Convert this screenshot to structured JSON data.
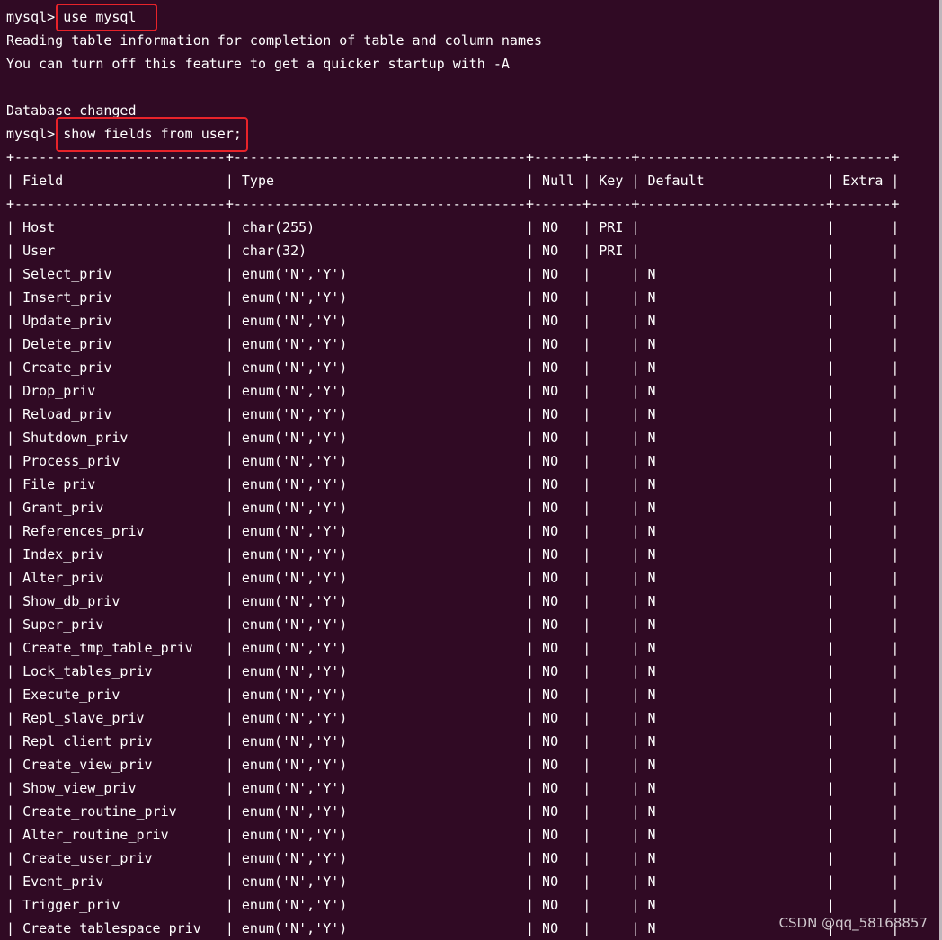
{
  "terminal": {
    "prompt": "mysql> ",
    "colors": {
      "background": "#300a24",
      "text": "#ffffff",
      "highlight_border": "#e8232a"
    },
    "lines": [
      {
        "prefix": "mysql> ",
        "text": "use mysql"
      },
      {
        "prefix": "",
        "text": "Reading table information for completion of table and column names"
      },
      {
        "prefix": "",
        "text": "You can turn off this feature to get a quicker startup with -A"
      },
      {
        "prefix": "",
        "text": ""
      },
      {
        "prefix": "",
        "text": "Database changed"
      },
      {
        "prefix": "mysql> ",
        "text": "show fields from user;"
      }
    ]
  },
  "table": {
    "border_line": "+--------------------------+------------------------------------+------+-----+-----------------------+-------+",
    "headers": [
      "Field",
      "Type",
      "Null",
      "Key",
      "Default",
      "Extra"
    ],
    "rows": [
      [
        "Host",
        "char(255)",
        "NO",
        "PRI",
        "",
        ""
      ],
      [
        "User",
        "char(32)",
        "NO",
        "PRI",
        "",
        ""
      ],
      [
        "Select_priv",
        "enum('N','Y')",
        "NO",
        "",
        "N",
        ""
      ],
      [
        "Insert_priv",
        "enum('N','Y')",
        "NO",
        "",
        "N",
        ""
      ],
      [
        "Update_priv",
        "enum('N','Y')",
        "NO",
        "",
        "N",
        ""
      ],
      [
        "Delete_priv",
        "enum('N','Y')",
        "NO",
        "",
        "N",
        ""
      ],
      [
        "Create_priv",
        "enum('N','Y')",
        "NO",
        "",
        "N",
        ""
      ],
      [
        "Drop_priv",
        "enum('N','Y')",
        "NO",
        "",
        "N",
        ""
      ],
      [
        "Reload_priv",
        "enum('N','Y')",
        "NO",
        "",
        "N",
        ""
      ],
      [
        "Shutdown_priv",
        "enum('N','Y')",
        "NO",
        "",
        "N",
        ""
      ],
      [
        "Process_priv",
        "enum('N','Y')",
        "NO",
        "",
        "N",
        ""
      ],
      [
        "File_priv",
        "enum('N','Y')",
        "NO",
        "",
        "N",
        ""
      ],
      [
        "Grant_priv",
        "enum('N','Y')",
        "NO",
        "",
        "N",
        ""
      ],
      [
        "References_priv",
        "enum('N','Y')",
        "NO",
        "",
        "N",
        ""
      ],
      [
        "Index_priv",
        "enum('N','Y')",
        "NO",
        "",
        "N",
        ""
      ],
      [
        "Alter_priv",
        "enum('N','Y')",
        "NO",
        "",
        "N",
        ""
      ],
      [
        "Show_db_priv",
        "enum('N','Y')",
        "NO",
        "",
        "N",
        ""
      ],
      [
        "Super_priv",
        "enum('N','Y')",
        "NO",
        "",
        "N",
        ""
      ],
      [
        "Create_tmp_table_priv",
        "enum('N','Y')",
        "NO",
        "",
        "N",
        ""
      ],
      [
        "Lock_tables_priv",
        "enum('N','Y')",
        "NO",
        "",
        "N",
        ""
      ],
      [
        "Execute_priv",
        "enum('N','Y')",
        "NO",
        "",
        "N",
        ""
      ],
      [
        "Repl_slave_priv",
        "enum('N','Y')",
        "NO",
        "",
        "N",
        ""
      ],
      [
        "Repl_client_priv",
        "enum('N','Y')",
        "NO",
        "",
        "N",
        ""
      ],
      [
        "Create_view_priv",
        "enum('N','Y')",
        "NO",
        "",
        "N",
        ""
      ],
      [
        "Show_view_priv",
        "enum('N','Y')",
        "NO",
        "",
        "N",
        ""
      ],
      [
        "Create_routine_priv",
        "enum('N','Y')",
        "NO",
        "",
        "N",
        ""
      ],
      [
        "Alter_routine_priv",
        "enum('N','Y')",
        "NO",
        "",
        "N",
        ""
      ],
      [
        "Create_user_priv",
        "enum('N','Y')",
        "NO",
        "",
        "N",
        ""
      ],
      [
        "Event_priv",
        "enum('N','Y')",
        "NO",
        "",
        "N",
        ""
      ],
      [
        "Trigger_priv",
        "enum('N','Y')",
        "NO",
        "",
        "N",
        ""
      ],
      [
        "Create_tablespace_priv",
        "enum('N','Y')",
        "NO",
        "",
        "N",
        ""
      ]
    ]
  },
  "watermark": "CSDN @qq_58168857"
}
